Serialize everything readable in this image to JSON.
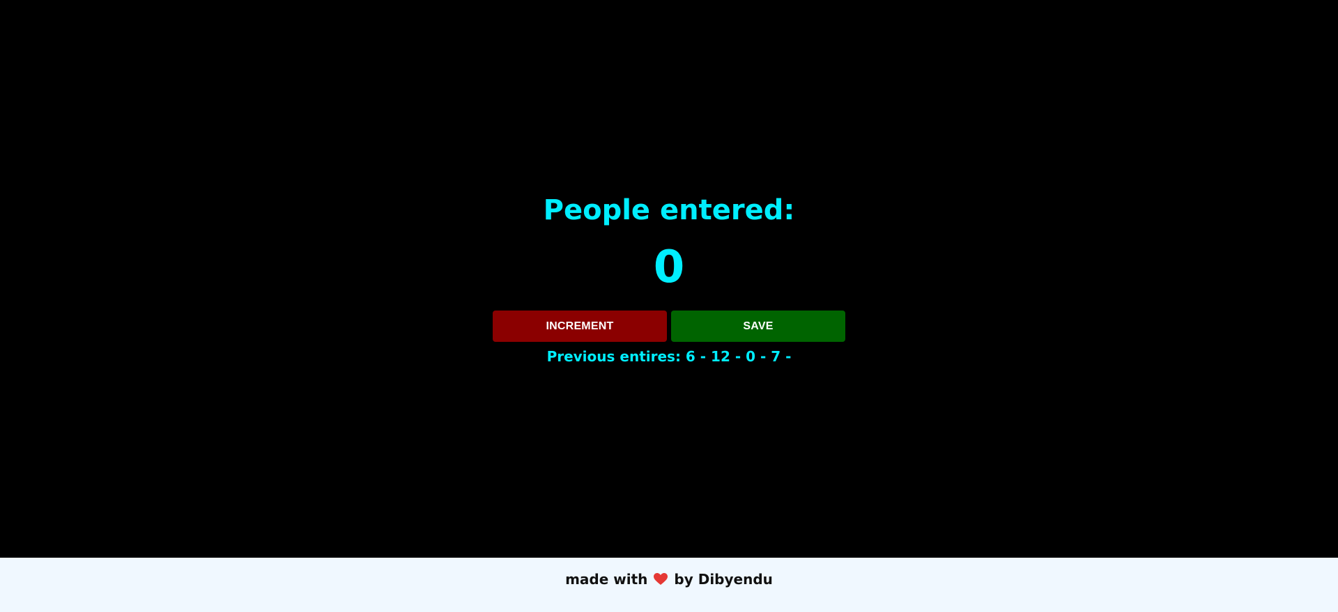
{
  "counter": {
    "title": "People entered:",
    "count": "0",
    "previous_entries": "Previous entires: 6 - 12 - 0 - 7 -"
  },
  "buttons": {
    "increment_label": "INCREMENT",
    "save_label": "SAVE"
  },
  "footer": {
    "prefix": "made with",
    "suffix": "by Dibyendu",
    "icon": "heart-icon"
  },
  "colors": {
    "background": "#000000",
    "accent_text": "#00eeff",
    "increment_button": "#8b0000",
    "save_button": "#006400",
    "footer_background": "#f0f8ff",
    "heart": "#e53935"
  }
}
